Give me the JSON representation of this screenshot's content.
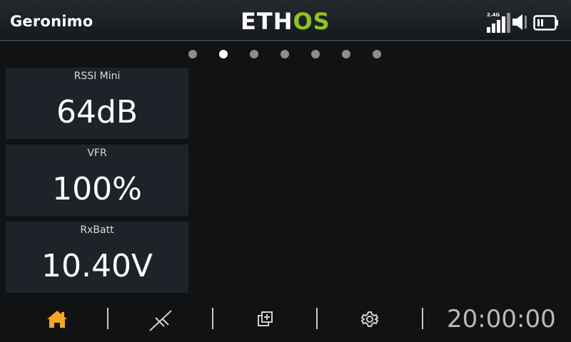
{
  "header": {
    "model_name": "Geronimo",
    "logo_main": "ETH",
    "logo_accent": "OS",
    "band_label": "2.4G",
    "accent_color": "#8fc320"
  },
  "pages": {
    "count": 7,
    "active_index": 1
  },
  "widgets": [
    {
      "title": "RSSI Mini",
      "value": "64dB"
    },
    {
      "title": "VFR",
      "value": "100%"
    },
    {
      "title": "RxBatt",
      "value": "10.40V"
    }
  ],
  "footer": {
    "home_icon": "home-icon",
    "model_icon": "model-icon",
    "widgets_icon": "add-widget-icon",
    "settings_icon": "gear-icon",
    "clock": "20:00:00",
    "home_color": "#f5a623"
  }
}
